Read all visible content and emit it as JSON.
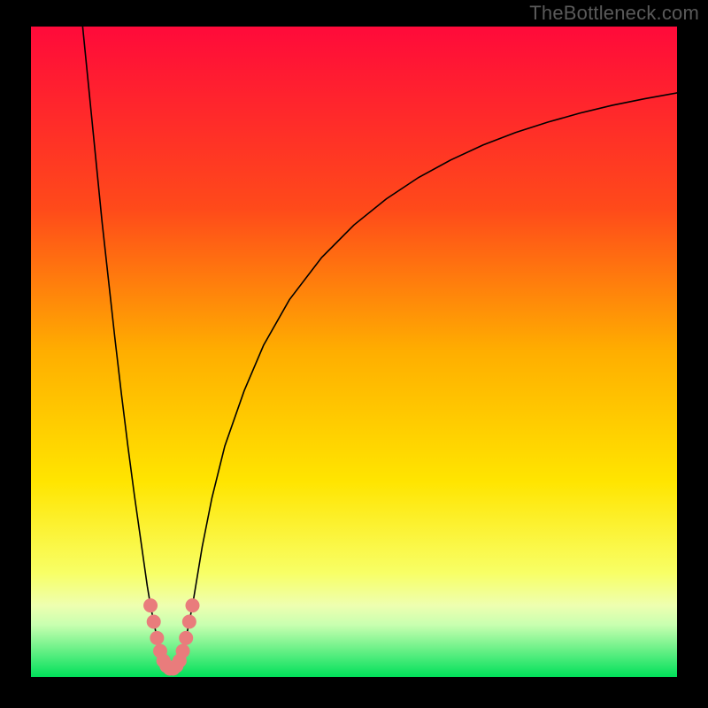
{
  "watermark": "TheBottleneck.com",
  "chart_data": {
    "type": "line",
    "title": "",
    "xlabel": "",
    "ylabel": "",
    "xlim": [
      0,
      100
    ],
    "ylim": [
      0,
      100
    ],
    "gradient_stops": [
      {
        "offset": 0,
        "color": "#ff0a3a"
      },
      {
        "offset": 28,
        "color": "#ff4a1a"
      },
      {
        "offset": 50,
        "color": "#ffae00"
      },
      {
        "offset": 70,
        "color": "#ffe500"
      },
      {
        "offset": 84,
        "color": "#f8ff66"
      },
      {
        "offset": 89,
        "color": "#eeffb0"
      },
      {
        "offset": 92,
        "color": "#c8ffb0"
      },
      {
        "offset": 100,
        "color": "#00e05a"
      }
    ],
    "series": [
      {
        "name": "bottleneck-curve",
        "color": "#000000",
        "stroke_width": 1.6,
        "points": [
          {
            "x": 8.0,
            "y": 100.0
          },
          {
            "x": 9.0,
            "y": 90.0
          },
          {
            "x": 10.0,
            "y": 80.0
          },
          {
            "x": 11.0,
            "y": 70.0
          },
          {
            "x": 12.0,
            "y": 61.0
          },
          {
            "x": 13.0,
            "y": 52.0
          },
          {
            "x": 14.0,
            "y": 43.5
          },
          {
            "x": 15.0,
            "y": 35.5
          },
          {
            "x": 16.0,
            "y": 28.0
          },
          {
            "x": 17.0,
            "y": 21.0
          },
          {
            "x": 17.5,
            "y": 17.5
          },
          {
            "x": 18.0,
            "y": 14.0
          },
          {
            "x": 18.5,
            "y": 11.0
          },
          {
            "x": 19.0,
            "y": 8.5
          },
          {
            "x": 19.5,
            "y": 6.0
          },
          {
            "x": 20.0,
            "y": 4.0
          },
          {
            "x": 20.5,
            "y": 2.5
          },
          {
            "x": 21.0,
            "y": 1.7
          },
          {
            "x": 21.5,
            "y": 1.3
          },
          {
            "x": 22.0,
            "y": 1.3
          },
          {
            "x": 22.5,
            "y": 1.7
          },
          {
            "x": 23.0,
            "y": 2.5
          },
          {
            "x": 23.5,
            "y": 4.0
          },
          {
            "x": 24.0,
            "y": 6.0
          },
          {
            "x": 24.5,
            "y": 8.5
          },
          {
            "x": 25.0,
            "y": 11.0
          },
          {
            "x": 25.5,
            "y": 14.0
          },
          {
            "x": 26.5,
            "y": 20.0
          },
          {
            "x": 28.0,
            "y": 27.5
          },
          {
            "x": 30.0,
            "y": 35.5
          },
          {
            "x": 33.0,
            "y": 44.0
          },
          {
            "x": 36.0,
            "y": 51.0
          },
          {
            "x": 40.0,
            "y": 58.0
          },
          {
            "x": 45.0,
            "y": 64.5
          },
          {
            "x": 50.0,
            "y": 69.5
          },
          {
            "x": 55.0,
            "y": 73.5
          },
          {
            "x": 60.0,
            "y": 76.8
          },
          {
            "x": 65.0,
            "y": 79.5
          },
          {
            "x": 70.0,
            "y": 81.8
          },
          {
            "x": 75.0,
            "y": 83.7
          },
          {
            "x": 80.0,
            "y": 85.3
          },
          {
            "x": 85.0,
            "y": 86.7
          },
          {
            "x": 90.0,
            "y": 87.9
          },
          {
            "x": 95.0,
            "y": 88.9
          },
          {
            "x": 100.0,
            "y": 89.8
          }
        ]
      },
      {
        "name": "highlight-markers",
        "color": "#e97c7c",
        "marker_radius": 8,
        "type": "scatter",
        "points": [
          {
            "x": 18.5,
            "y": 11.0
          },
          {
            "x": 19.0,
            "y": 8.5
          },
          {
            "x": 19.5,
            "y": 6.0
          },
          {
            "x": 20.0,
            "y": 4.0
          },
          {
            "x": 20.5,
            "y": 2.5
          },
          {
            "x": 21.0,
            "y": 1.7
          },
          {
            "x": 21.5,
            "y": 1.3
          },
          {
            "x": 22.0,
            "y": 1.3
          },
          {
            "x": 22.5,
            "y": 1.7
          },
          {
            "x": 23.0,
            "y": 2.5
          },
          {
            "x": 23.5,
            "y": 4.0
          },
          {
            "x": 24.0,
            "y": 6.0
          },
          {
            "x": 24.5,
            "y": 8.5
          },
          {
            "x": 25.0,
            "y": 11.0
          }
        ]
      }
    ]
  }
}
